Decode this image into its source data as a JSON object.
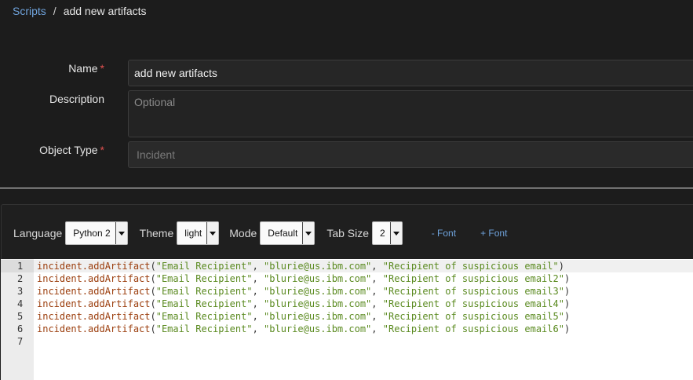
{
  "breadcrumb": {
    "root": "Scripts",
    "separator": "/",
    "current": "add new artifacts"
  },
  "form": {
    "name_label": "Name",
    "name_value": "add new artifacts",
    "description_label": "Description",
    "description_placeholder": "Optional",
    "object_type_label": "Object Type",
    "object_type_value": "Incident",
    "required_marker": "*"
  },
  "toolbar": {
    "language_label": "Language",
    "language_value": "Python 2",
    "theme_label": "Theme",
    "theme_value": "light",
    "mode_label": "Mode",
    "mode_value": "Default",
    "tabsize_label": "Tab Size",
    "tabsize_value": "2",
    "font_decrease": "- Font",
    "font_increase": "+ Font"
  },
  "code": {
    "lines": [
      {
        "n": "1",
        "fn": "incident.addArtifact",
        "a": "\"Email Recipient\"",
        "b": "\"blurie@us.ibm.com\"",
        "c": "\"Recipient of suspicious email\""
      },
      {
        "n": "2",
        "fn": "incident.addArtifact",
        "a": "\"Email Recipient\"",
        "b": "\"blurie@us.ibm.com\"",
        "c": "\"Recipient of suspicious email2\""
      },
      {
        "n": "3",
        "fn": "incident.addArtifact",
        "a": "\"Email Recipient\"",
        "b": "\"blurie@us.ibm.com\"",
        "c": "\"Recipient of suspicious email3\""
      },
      {
        "n": "4",
        "fn": "incident.addArtifact",
        "a": "\"Email Recipient\"",
        "b": "\"blurie@us.ibm.com\"",
        "c": "\"Recipient of suspicious email4\""
      },
      {
        "n": "5",
        "fn": "incident.addArtifact",
        "a": "\"Email Recipient\"",
        "b": "\"blurie@us.ibm.com\"",
        "c": "\"Recipient of suspicious email5\""
      },
      {
        "n": "6",
        "fn": "incident.addArtifact",
        "a": "\"Email Recipient\"",
        "b": "\"blurie@us.ibm.com\"",
        "c": "\"Recipient of suspicious email6\""
      },
      {
        "n": "7",
        "fn": "",
        "a": "",
        "b": "",
        "c": ""
      }
    ]
  }
}
